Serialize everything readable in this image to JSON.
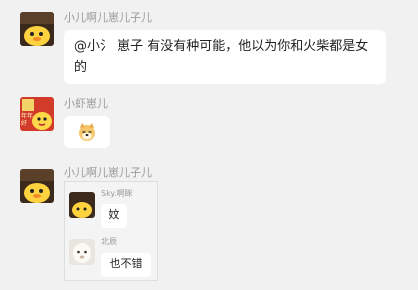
{
  "messages": [
    {
      "sender": "小儿啊儿崽儿子儿",
      "text": "@小氵 崽子 有没有种可能，他以为你和火柴都是女的"
    },
    {
      "sender": "小虾崽儿",
      "emoji_icon": "dog-face-emoji"
    },
    {
      "sender": "小儿啊儿崽儿子儿"
    }
  ],
  "quoted": [
    {
      "sender": "Sky.啊眯",
      "text": "妏"
    },
    {
      "sender": "北辰",
      "text": "也不错"
    }
  ],
  "avatar_badge": "年年好"
}
